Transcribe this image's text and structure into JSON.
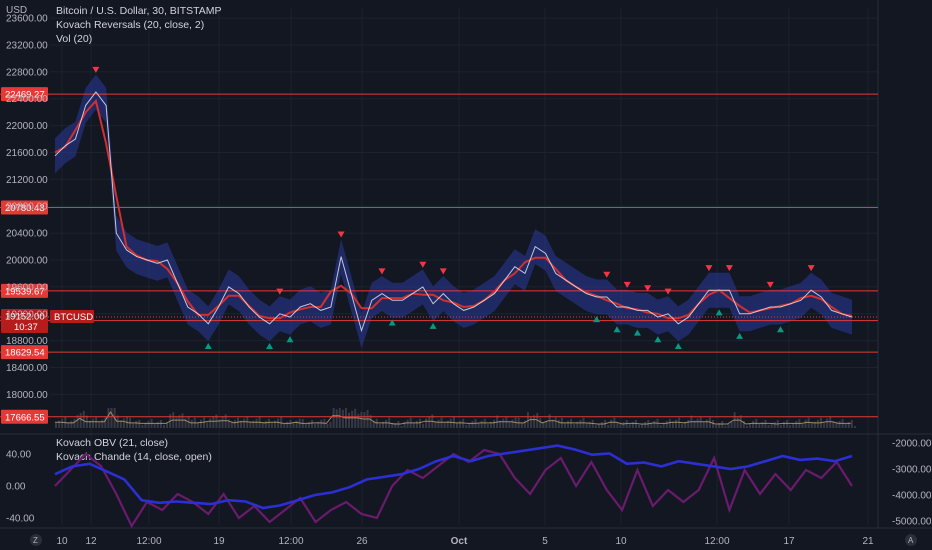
{
  "header": {
    "currency": "USD",
    "title_line": "Bitcoin / U.S. Dollar, 30, BITSTAMP",
    "indicator_1": "Kovach Reversals (20, close, 2)",
    "indicator_2": "Vol (20)"
  },
  "footer": {
    "left_icon": "Z",
    "right_icon": "A"
  },
  "colors": {
    "background": "#131722",
    "grid": "#1e222d",
    "price_line": "#e0e3eb",
    "band": "#2a3b9c",
    "ma": "#d32f2f",
    "level": "#e53935",
    "down_marker": "#f23645",
    "up_marker": "#089981",
    "obv": "#2c2fd4",
    "chande": "#6a1b6e",
    "volume": "#c8a26b"
  },
  "chart_data": [
    {
      "type": "line",
      "pane": "price",
      "series": [
        {
          "name": "BTCUSD",
          "values": [
            21550,
            21700,
            21800,
            22300,
            22500,
            22300,
            20400,
            20150,
            20050,
            20000,
            19950,
            20000,
            19650,
            19300,
            19200,
            19050,
            19300,
            19600,
            19500,
            19300,
            19150,
            19050,
            19200,
            19150,
            19300,
            19350,
            19250,
            19300,
            20050,
            19500,
            18950,
            19400,
            19500,
            19400,
            19400,
            19500,
            19600,
            19350,
            19500,
            19350,
            19250,
            19300,
            19400,
            19500,
            19700,
            19900,
            19800,
            20200,
            20100,
            19800,
            19700,
            19600,
            19500,
            19450,
            19450,
            19300,
            19300,
            19250,
            19250,
            19150,
            19200,
            19050,
            19150,
            19350,
            19550,
            19550,
            19550,
            19200,
            19200,
            19250,
            19300,
            19300,
            19350,
            19400,
            19550,
            19450,
            19250,
            19200,
            19150
          ]
        }
      ],
      "y_ticks": [
        23600,
        23200,
        22800,
        22400,
        22000,
        21600,
        21200,
        20800,
        20400,
        20000,
        19600,
        19200,
        18800,
        18400,
        18000
      ],
      "ylim": [
        17500,
        23750
      ],
      "price_levels": [
        "22469.27",
        "20780.43",
        "19539.67",
        "19098.36",
        "18629.54",
        "17666.55"
      ],
      "current_price": "19152.00",
      "countdown": "10:37",
      "symbol": "BTCUSD",
      "x_ticks": [
        "10",
        "12",
        "12:00",
        "19",
        "12:00",
        "26",
        "Oct",
        "5",
        "10",
        "12:00",
        "17",
        "21"
      ]
    },
    {
      "type": "line",
      "pane": "oscillator",
      "title_obv": "Kovach OBV (21, close)",
      "title_chande": "Kovach Chande (14, close, open)",
      "left_ticks": [
        "40.00",
        "0.00",
        "-40.00"
      ],
      "right_ticks": [
        "-2000.00",
        "-3000.00",
        "-4000.00",
        "-5000.00"
      ],
      "series": [
        {
          "name": "Kovach OBV (21, close)",
          "values": [
            -3200,
            -2900,
            -2800,
            -3100,
            -3400,
            -4200,
            -4300,
            -4250,
            -4300,
            -4350,
            -4200,
            -4250,
            -4500,
            -4400,
            -4200,
            -4000,
            -3900,
            -3700,
            -3400,
            -3300,
            -3200,
            -3000,
            -2700,
            -2500,
            -2700,
            -2500,
            -2400,
            -2300,
            -2200,
            -2100,
            -2250,
            -2450,
            -2400,
            -2800,
            -2750,
            -2900,
            -2700,
            -2800,
            -2900,
            -3000,
            -2900,
            -2700,
            -2500,
            -2650,
            -2600,
            -2700,
            -2500
          ]
        },
        {
          "name": "Kovach Chande (14, close, open)",
          "values": [
            0,
            20,
            40,
            25,
            -10,
            -50,
            -20,
            -30,
            -10,
            -20,
            -35,
            -10,
            -40,
            -25,
            -45,
            -30,
            -15,
            -45,
            -30,
            -20,
            -35,
            -40,
            0,
            20,
            10,
            25,
            40,
            30,
            45,
            40,
            10,
            -10,
            20,
            35,
            0,
            30,
            -5,
            -30,
            20,
            -25,
            -5,
            -20,
            -5,
            35,
            -30,
            20,
            -10,
            15,
            -5,
            20,
            10,
            30,
            0
          ]
        }
      ]
    }
  ]
}
